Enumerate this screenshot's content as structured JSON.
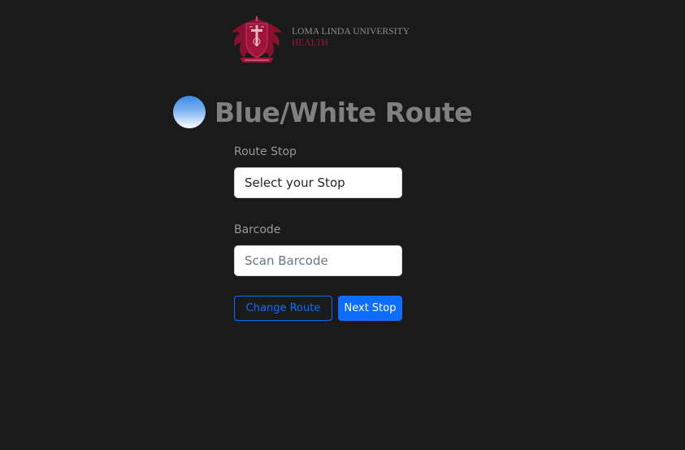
{
  "logo": {
    "line1": "LOMA LINDA UNIVERSITY",
    "line2": "HEALTH",
    "brand_color": "#a1143a"
  },
  "route": {
    "title": "Blue/White Route",
    "indicator_colors": [
      "#3b8ae8",
      "#ffffff"
    ]
  },
  "form": {
    "route_stop": {
      "label": "Route Stop",
      "selected": "Select your Stop"
    },
    "barcode": {
      "label": "Barcode",
      "value": "",
      "placeholder": "Scan Barcode"
    }
  },
  "buttons": {
    "change_route": "Change Route",
    "next_stop": "Next Stop",
    "primary_color": "#0d6efd"
  }
}
